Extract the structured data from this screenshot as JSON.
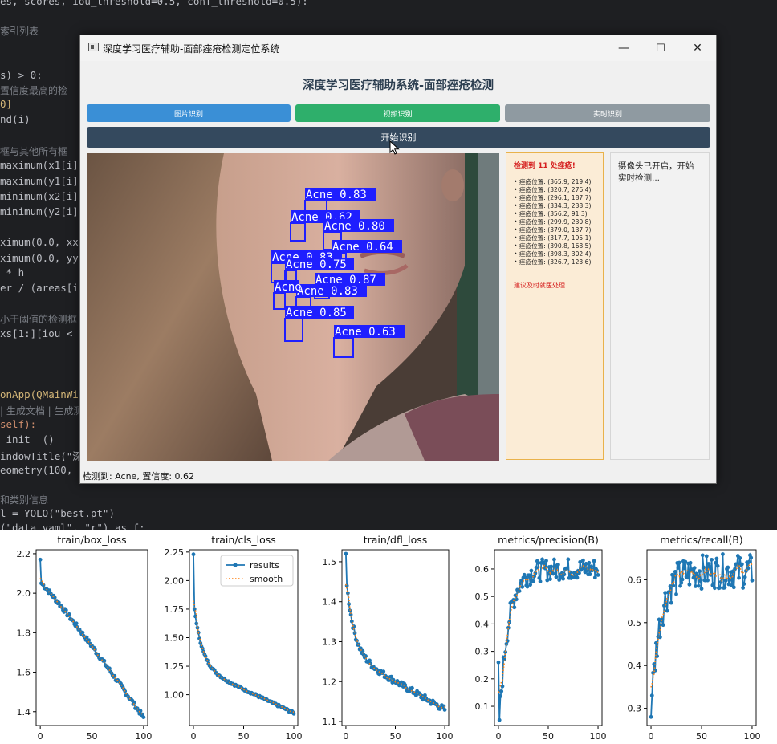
{
  "editor": {
    "lines": [
      {
        "parts": [
          {
            "t": "es, scores, iou_threshold=0.5, conf_threshold=0.5):",
            "c": ""
          }
        ]
      },
      {
        "parts": [
          {
            "t": "索引列表",
            "c": "cm"
          }
        ]
      },
      {
        "parts": [
          {
            "t": "s) > 0:",
            "c": ""
          }
        ]
      },
      {
        "parts": [
          {
            "t": "置信度最高的检",
            "c": "cm"
          }
        ]
      },
      {
        "parts": [
          {
            "t": "0]",
            "c": "yl"
          }
        ]
      },
      {
        "parts": [
          {
            "t": "nd(i)",
            "c": ""
          }
        ]
      },
      {
        "parts": [
          {
            "t": "框与其他所有框",
            "c": "cm"
          }
        ]
      },
      {
        "parts": [
          {
            "t": "maximum(x1[i]",
            "c": ""
          }
        ]
      },
      {
        "parts": [
          {
            "t": "maximum(y1[i]",
            "c": ""
          }
        ]
      },
      {
        "parts": [
          {
            "t": "minimum(x2[i]",
            "c": ""
          }
        ]
      },
      {
        "parts": [
          {
            "t": "minimum(y2[i]",
            "c": ""
          }
        ]
      },
      {
        "parts": [
          {
            "t": "ximum(0.0, xx",
            "c": ""
          }
        ]
      },
      {
        "parts": [
          {
            "t": "ximum(0.0, yy",
            "c": ""
          }
        ]
      },
      {
        "parts": [
          {
            "t": " * h",
            "c": ""
          }
        ]
      },
      {
        "parts": [
          {
            "t": "er / (areas[i",
            "c": ""
          }
        ]
      },
      {
        "parts": [
          {
            "t": "小于阈值的检测框",
            "c": "cm"
          }
        ]
      },
      {
        "parts": [
          {
            "t": "xs[1:][iou < ",
            "c": ""
          }
        ]
      },
      {
        "parts": [
          {
            "t": "onApp(QMainWi",
            "c": "yl"
          }
        ]
      },
      {
        "parts": [
          {
            "t": "| 生成文档 | 生成测",
            "c": "cm"
          }
        ]
      },
      {
        "parts": [
          {
            "t": "self):",
            "c": "kw"
          }
        ]
      },
      {
        "parts": [
          {
            "t": "_init__()",
            "c": ""
          }
        ]
      },
      {
        "parts": [
          {
            "t": "indowTitle(\"深",
            "c": ""
          }
        ]
      },
      {
        "parts": [
          {
            "t": "eometry(100, ",
            "c": ""
          }
        ]
      },
      {
        "parts": [
          {
            "t": "和类别信息",
            "c": "cm"
          }
        ]
      },
      {
        "parts": [
          {
            "t": "l = YOLO(\"best.pt\")",
            "c": ""
          }
        ]
      },
      {
        "parts": [
          {
            "t": "(\"data.yaml\", \"r\") as f:",
            "c": ""
          }
        ]
      }
    ]
  },
  "window": {
    "title": "深度学习医疗辅助-面部痤疮检测定位系统",
    "minimize": "—",
    "maximize": "☐",
    "close": "✕",
    "heading": "深度学习医疗辅助系统-面部痤疮检测",
    "tabs": [
      {
        "label": "图片识别",
        "color": "#3a8fd6"
      },
      {
        "label": "视频识别",
        "color": "#2eaf6b"
      },
      {
        "label": "实时识别",
        "color": "#8f9aa1"
      }
    ],
    "start_button": "开始识别",
    "detections": [
      {
        "label": "Acne 0.83"
      },
      {
        "label": "Acne 0.62"
      },
      {
        "label": "Acne 0.80"
      },
      {
        "label": "Acne 0.64"
      },
      {
        "label": "Acne 0.83"
      },
      {
        "label": "Acne 0.75"
      },
      {
        "label": "Acne 0.87"
      },
      {
        "label": "Acne 0.83"
      },
      {
        "label": "Acne"
      },
      {
        "label": "Acne 0.85"
      },
      {
        "label": "Acne 0.63"
      }
    ],
    "result_panel": {
      "heading": "检测到 11 处痤疮!",
      "items": [
        "• 痤疮位置: (365.9, 219.4)",
        "• 痤疮位置: (320.7, 276.4)",
        "• 痤疮位置: (296.1, 187.7)",
        "• 痤疮位置: (334.3, 238.3)",
        "• 痤疮位置: (356.2, 91.3)",
        "• 痤疮位置: (299.9, 230.8)",
        "• 痤疮位置: (379.0, 137.7)",
        "• 痤疮位置: (317.7, 195.1)",
        "• 痤疮位置: (390.8, 168.5)",
        "• 痤疮位置: (398.3, 302.4)",
        "• 痤疮位置: (326.7, 123.6)"
      ],
      "advice": "建议及时就医处理"
    },
    "log_text": "摄像头已开启，开始实时检测...",
    "status": "检测到: Acne, 置信度: 0.62"
  },
  "colors": {
    "box": "#1f1fff",
    "line": "#1f77b4",
    "smooth": "#ff7f0e"
  },
  "chart_data": [
    {
      "type": "line",
      "title": "train/box_loss",
      "ylim": [
        1.33,
        2.22
      ],
      "yticks": [
        "1.4",
        "1.6",
        "1.8",
        "2.0",
        "2.2"
      ],
      "ytick_values": [
        1.4,
        1.6,
        1.8,
        2.0,
        2.2
      ],
      "xlim": [
        -4,
        104
      ],
      "xticks": [
        "0",
        "50",
        "100"
      ],
      "ytick_values_ref": "",
      "start": 2.17,
      "second": 2.05,
      "end": 1.37,
      "noise": 0.012,
      "shape": "linear",
      "legend": false
    },
    {
      "type": "line",
      "title": "train/cls_loss",
      "ylim": [
        0.73,
        2.27
      ],
      "yticks": [
        "1.00",
        "1.25",
        "1.50",
        "1.75",
        "2.00",
        "2.25"
      ],
      "ytick_values": [
        1.0,
        1.25,
        1.5,
        1.75,
        2.0,
        2.25
      ],
      "xlim": [
        -4,
        104
      ],
      "xticks": [
        "0",
        "50",
        "100"
      ],
      "start": 2.23,
      "second": 1.75,
      "end": 0.84,
      "noise": 0.01,
      "shape": "decay",
      "legend": true,
      "series_names": [
        "results",
        "smooth"
      ]
    },
    {
      "type": "line",
      "title": "train/dfl_loss",
      "ylim": [
        1.09,
        1.53
      ],
      "yticks": [
        "1.1",
        "1.2",
        "1.3",
        "1.4",
        "1.5"
      ],
      "ytick_values": [
        1.1,
        1.2,
        1.3,
        1.4,
        1.5
      ],
      "xlim": [
        -4,
        104
      ],
      "xticks": [
        "0",
        "50",
        "100"
      ],
      "start": 1.52,
      "second": 1.44,
      "end": 1.13,
      "noise": 0.008,
      "shape": "decay",
      "legend": false
    },
    {
      "type": "line",
      "title": "metrics/precision(B)",
      "ylim": [
        0.03,
        0.67
      ],
      "yticks": [
        "0.1",
        "0.2",
        "0.3",
        "0.4",
        "0.5",
        "0.6"
      ],
      "ytick_values": [
        0.1,
        0.2,
        0.3,
        0.4,
        0.5,
        0.6
      ],
      "xlim": [
        -4,
        104
      ],
      "xticks": [
        "0",
        "50",
        "100"
      ],
      "start": 0.26,
      "second": 0.05,
      "end": 0.6,
      "noise": 0.025,
      "shape": "rise",
      "legend": false
    },
    {
      "type": "line",
      "title": "metrics/recall(B)",
      "ylim": [
        0.26,
        0.67
      ],
      "yticks": [
        "0.3",
        "0.4",
        "0.5",
        "0.6"
      ],
      "ytick_values": [
        0.3,
        0.4,
        0.5,
        0.6
      ],
      "xlim": [
        -4,
        104
      ],
      "xticks": [
        "0",
        "50",
        "100"
      ],
      "start": 0.28,
      "second": 0.33,
      "end": 0.62,
      "noise": 0.025,
      "shape": "rise",
      "legend": false
    }
  ]
}
